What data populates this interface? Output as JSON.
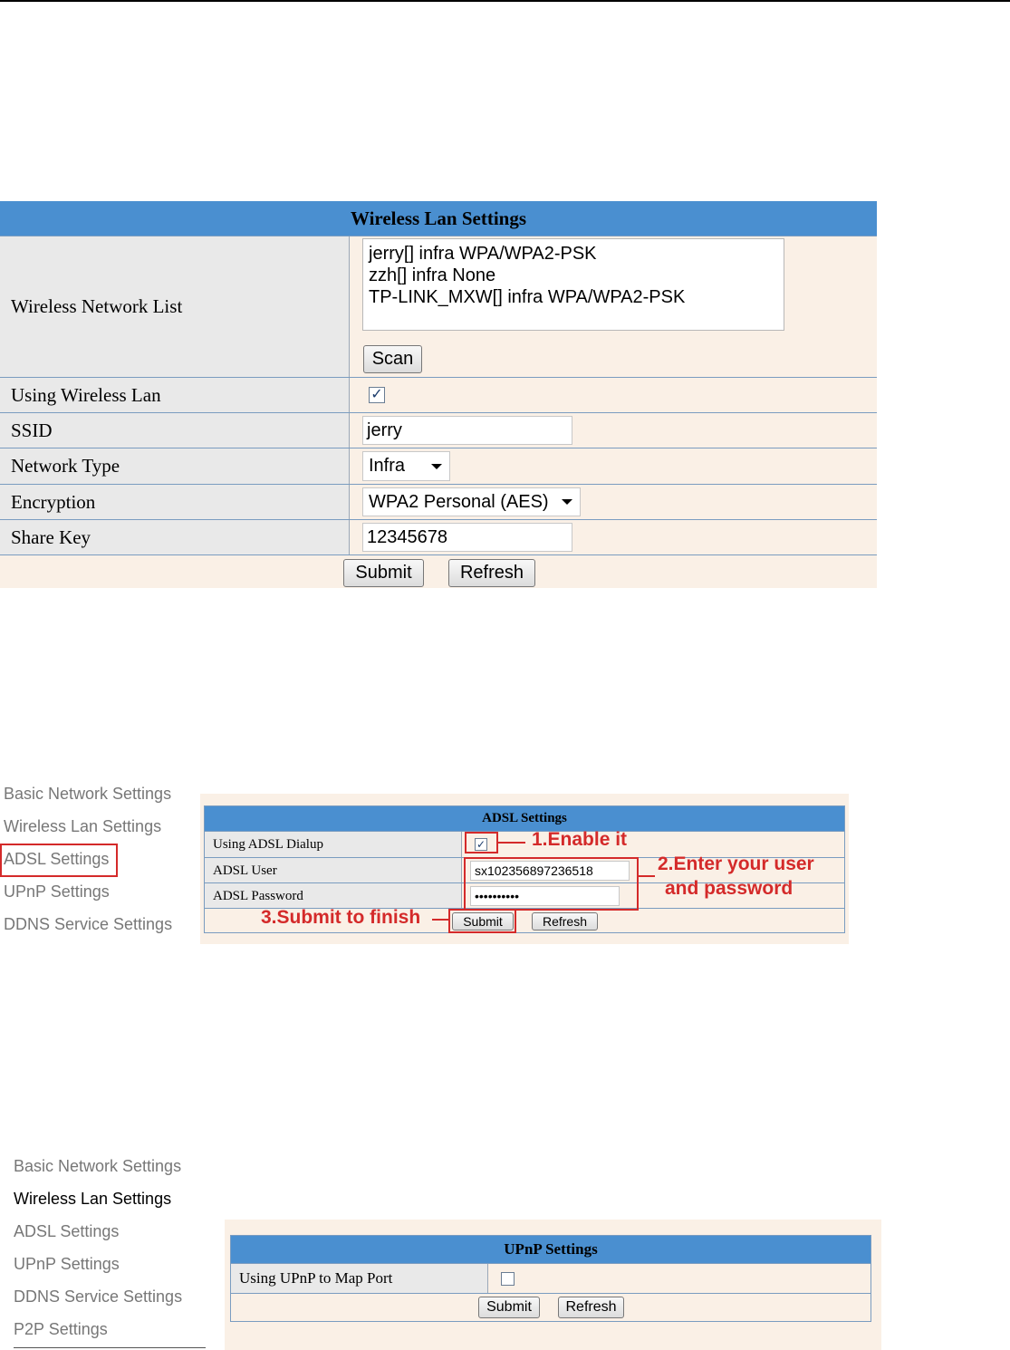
{
  "wireless": {
    "title": "Wireless Lan Settings",
    "network_list_label": "Wireless Network List",
    "networks": [
      "jerry[] infra WPA/WPA2-PSK",
      "zzh[] infra None",
      "TP-LINK_MXW[] infra WPA/WPA2-PSK"
    ],
    "scan_label": "Scan",
    "using_label": "Using Wireless Lan",
    "using_checked": true,
    "ssid_label": "SSID",
    "ssid_value": "jerry",
    "network_type_label": "Network Type",
    "network_type_value": "Infra",
    "encryption_label": "Encryption",
    "encryption_value": "WPA2 Personal (AES)",
    "share_key_label": "Share Key",
    "share_key_value": "12345678",
    "submit_label": "Submit",
    "refresh_label": "Refresh"
  },
  "nav1": {
    "items": [
      "Basic Network Settings",
      "Wireless Lan Settings",
      "ADSL Settings",
      "UPnP Settings",
      "DDNS Service Settings"
    ]
  },
  "adsl": {
    "title": "ADSL Settings",
    "dialup_label": "Using ADSL Dialup",
    "dialup_checked": true,
    "user_label": "ADSL User",
    "user_value": "sx102356897236518",
    "password_label": "ADSL Password",
    "password_value": "••••••••••",
    "submit_label": "Submit",
    "refresh_label": "Refresh",
    "annotation_1": "1.Enable it",
    "annotation_2a": "2.Enter your user",
    "annotation_2b": "and password",
    "annotation_3": "3.Submit to finish"
  },
  "nav2": {
    "items": [
      "Basic Network Settings",
      "Wireless Lan Settings",
      "ADSL Settings",
      "UPnP Settings",
      "DDNS Service Settings",
      "P2P Settings"
    ]
  },
  "upnp": {
    "title": "UPnP Settings",
    "map_port_label": "Using UPnP to Map Port",
    "map_port_checked": false,
    "submit_label": "Submit",
    "refresh_label": "Refresh"
  },
  "colors": {
    "header_blue": "#4a8fd0",
    "panel_bg": "#faf0e6",
    "annotation_red": "#d42a2a"
  }
}
